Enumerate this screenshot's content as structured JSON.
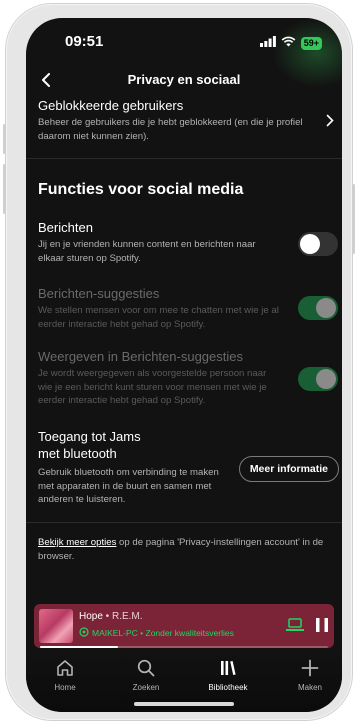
{
  "status_bar": {
    "time": "09:51",
    "battery": "59+"
  },
  "nav": {
    "title": "Privacy en sociaal"
  },
  "blocked": {
    "title": "Geblokkeerde gebruikers",
    "description": "Beheer de gebruikers die je hebt geblokkeerd (en die je profiel daarom niet kunnen zien)."
  },
  "section_heading": "Functies voor social media",
  "settings": [
    {
      "title": "Berichten",
      "description": "Jij en je vrienden kunnen content en berichten naar elkaar sturen op Spotify.",
      "enabled": false,
      "disabled": false
    },
    {
      "title": "Berichten-suggesties",
      "description": "We stellen mensen voor om mee te chatten met wie je al eerder interactie hebt gehad op Spotify.",
      "enabled": true,
      "disabled": true
    },
    {
      "title": "Weergeven in Berichten-suggesties",
      "description": "Je wordt weergegeven als voorgestelde persoon naar wie je een bericht kunt sturen voor mensen met wie je eerder interactie hebt gehad op Spotify.",
      "enabled": true,
      "disabled": true
    }
  ],
  "jams": {
    "title_line1": "Toegang tot Jams",
    "title_line2": "met bluetooth",
    "description": "Gebruik bluetooth om verbinding te maken met apparaten in de buurt en samen met anderen te luisteren.",
    "button_label": "Meer informatie"
  },
  "footer": {
    "link_text": "Bekijk meer opties",
    "text": " op de pagina 'Privacy-instellingen account' in de browser."
  },
  "now_playing": {
    "track": "Hope",
    "separator": " • ",
    "artist": "R.E.M.",
    "device": "MAIKEL-PC • Zonder kwaliteitsverlies",
    "progress": 0.27
  },
  "tabs": [
    {
      "label": "Home",
      "icon": "home-icon",
      "active": false
    },
    {
      "label": "Zoeken",
      "icon": "search-icon",
      "active": false
    },
    {
      "label": "Bibliotheek",
      "icon": "library-icon",
      "active": true
    },
    {
      "label": "Maken",
      "icon": "plus-icon",
      "active": false
    }
  ],
  "colors": {
    "background": "#121212",
    "accent_green": "#1ed760",
    "mini_player": "#7b2337",
    "text_secondary": "#b3b3b3"
  }
}
